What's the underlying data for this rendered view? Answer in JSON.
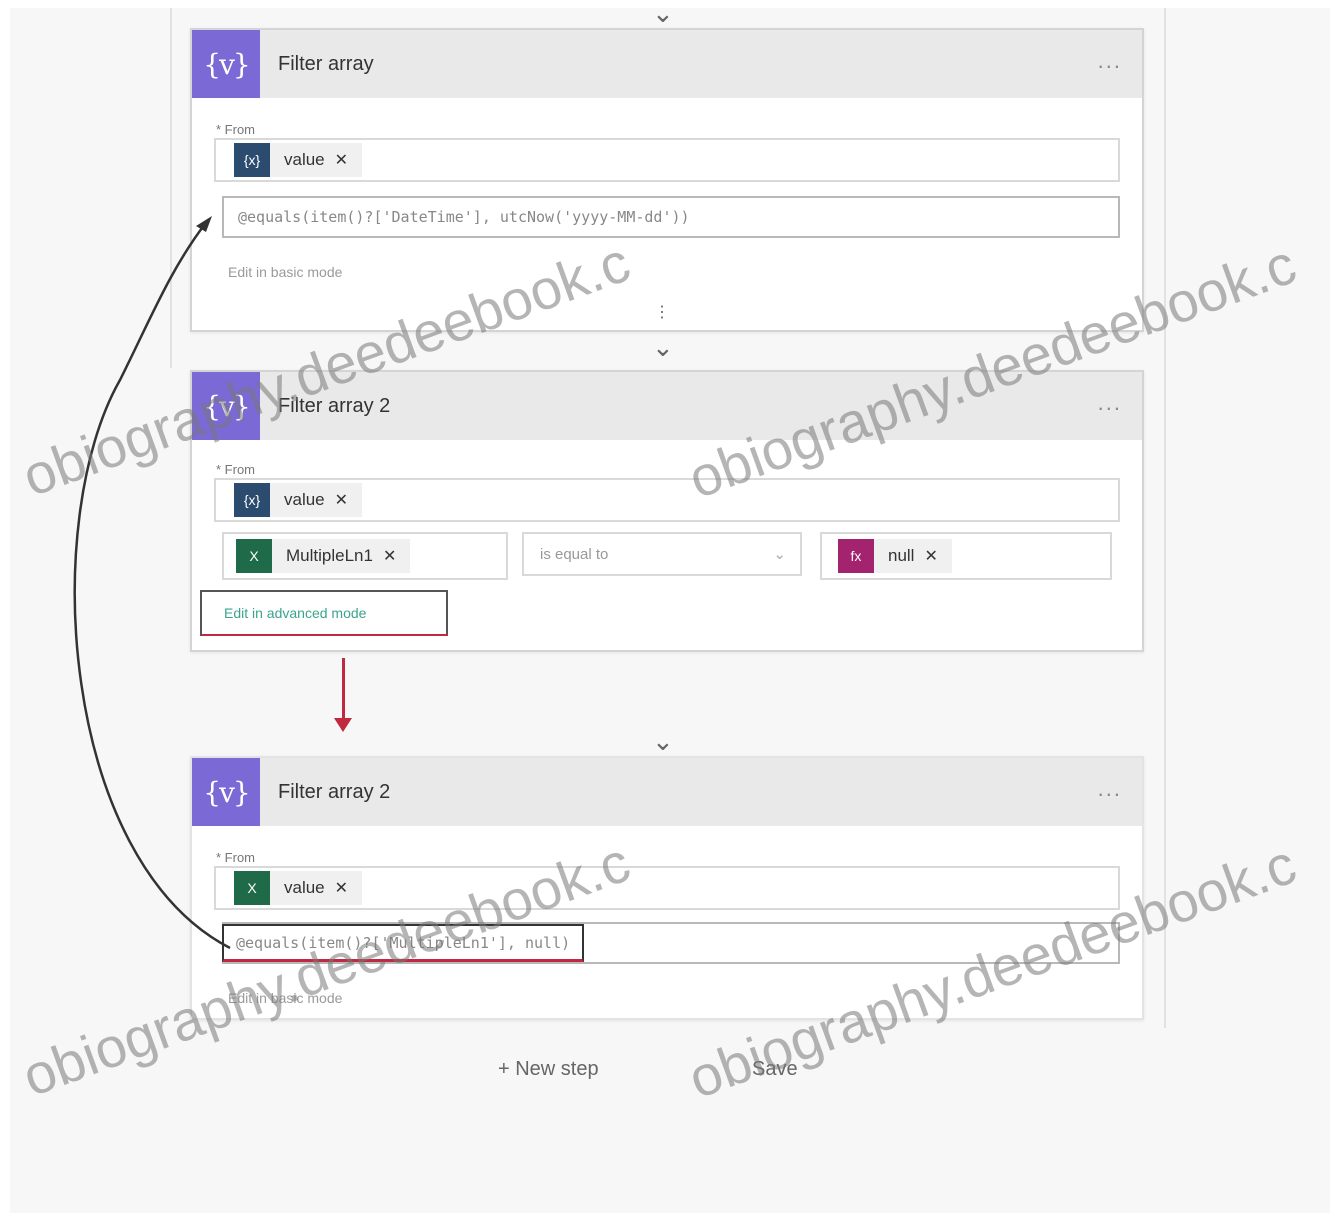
{
  "cards": [
    {
      "title": "Filter array",
      "icon_text": "{v}",
      "more": "...",
      "from_label": "* From",
      "token_label": "value",
      "token_x": "✕",
      "expression": "@equals(item()?['DateTime'], utcNow('yyyy-MM-dd'))",
      "basic_mode": "Edit in basic mode"
    },
    {
      "title": "Filter array 2",
      "icon_text": "{v}",
      "more": "...",
      "from_label": "* From",
      "token_label": "value",
      "token_x": "✕",
      "cond_left": "MultipleLn1",
      "cond_op": "is equal to",
      "cond_right": "null",
      "advanced_mode": "Edit in advanced mode"
    },
    {
      "title": "Filter array 2",
      "icon_text": "{v}",
      "more": "...",
      "from_label": "* From",
      "token_label": "value",
      "token_x": "✕",
      "expression": "@equals(item()?['MultipleLn1'], null)",
      "basic_mode": "Edit in basic mode"
    }
  ],
  "footer": {
    "new_step": "+ New step",
    "save": "Save"
  },
  "watermarks": [
    "obiography.deedeebook.c",
    "obiography.deedeebook.c",
    "obiography.deedeebook.c",
    "obiography.deedeebook.c"
  ],
  "colors": {
    "action_icon": "#7b69d6",
    "token_variable": "#2b4c6f",
    "token_excel": "#1f6b49",
    "token_expression": "#a3236f",
    "highlight_red": "#c0293f"
  }
}
